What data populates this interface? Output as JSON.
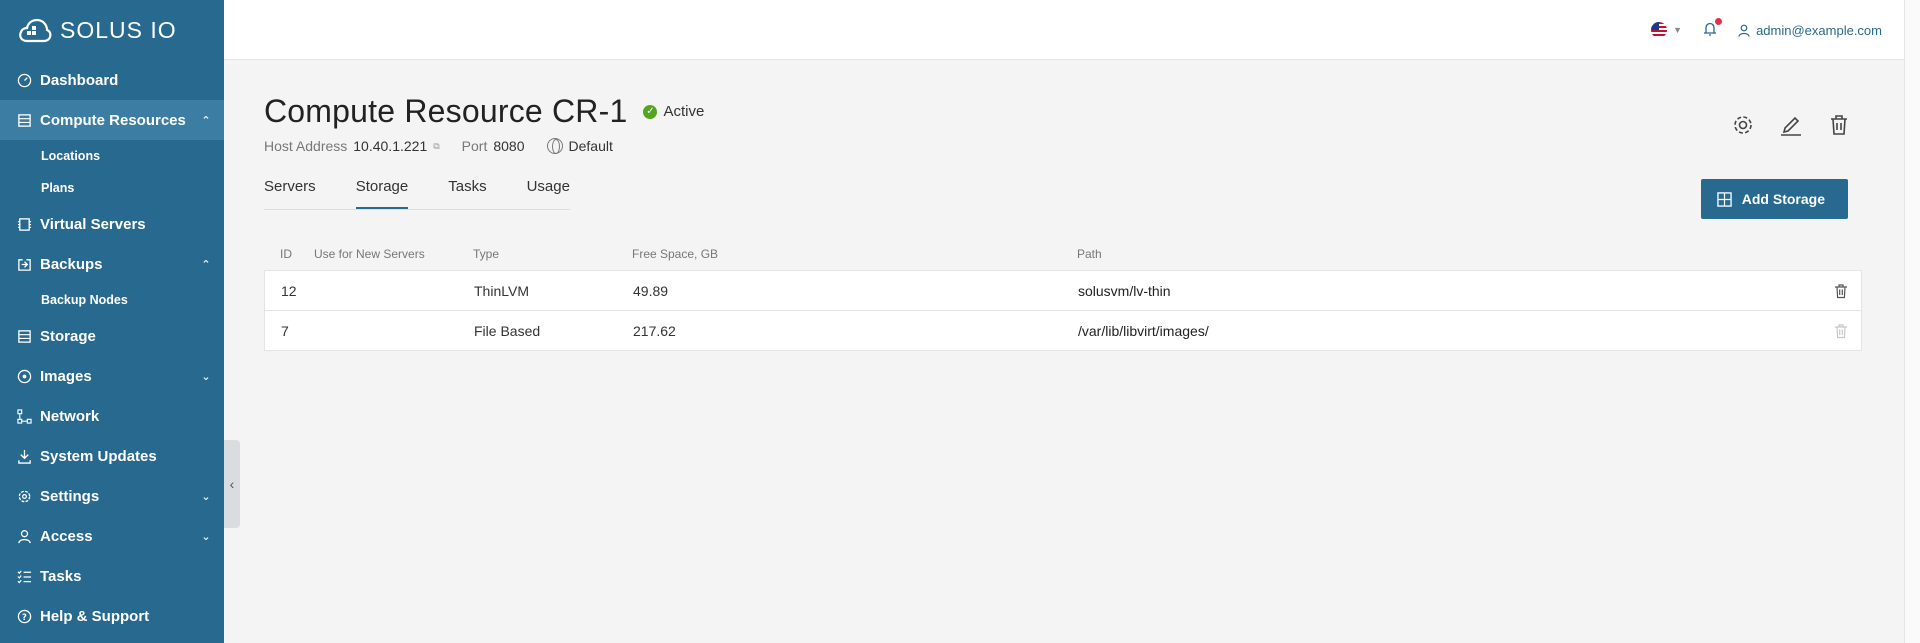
{
  "brand": {
    "name": "SOLUS IO"
  },
  "header": {
    "language_flag": "us-flag-icon",
    "user_email": "admin@example.com"
  },
  "sidebar": {
    "items": [
      {
        "label": "Dashboard",
        "icon": "dashboard-icon"
      },
      {
        "label": "Compute Resources",
        "icon": "compute-resources-icon",
        "expanded": true,
        "children": [
          {
            "label": "Locations"
          },
          {
            "label": "Plans"
          }
        ]
      },
      {
        "label": "Virtual Servers",
        "icon": "virtual-servers-icon"
      },
      {
        "label": "Backups",
        "icon": "backups-icon",
        "expanded": true,
        "children": [
          {
            "label": "Backup Nodes"
          }
        ]
      },
      {
        "label": "Storage",
        "icon": "storage-icon"
      },
      {
        "label": "Images",
        "icon": "images-icon",
        "expanded": false
      },
      {
        "label": "Network",
        "icon": "network-icon"
      },
      {
        "label": "System Updates",
        "icon": "system-updates-icon"
      },
      {
        "label": "Settings",
        "icon": "settings-icon",
        "expanded": false
      },
      {
        "label": "Access",
        "icon": "access-icon",
        "expanded": false
      },
      {
        "label": "Tasks",
        "icon": "tasks-icon"
      },
      {
        "label": "Help & Support",
        "icon": "help-icon"
      }
    ]
  },
  "page": {
    "title": "Compute Resource CR-1",
    "status": "Active",
    "host_label": "Host Address",
    "host_value": "10.40.1.221",
    "port_label": "Port",
    "port_value": "8080",
    "location": "Default",
    "tabs": [
      "Servers",
      "Storage",
      "Tasks",
      "Usage"
    ],
    "active_tab": "Storage",
    "add_button": "Add Storage"
  },
  "table": {
    "columns": [
      "ID",
      "Use for New Servers",
      "Type",
      "Free Space, GB",
      "Path"
    ],
    "rows": [
      {
        "id": "12",
        "use_for_new": false,
        "type": "ThinLVM",
        "free": "49.89",
        "path": "solusvm/lv-thin"
      },
      {
        "id": "7",
        "use_for_new": true,
        "type": "File Based",
        "free": "217.62",
        "path": "/var/lib/libvirt/images/"
      }
    ]
  },
  "colors": {
    "sidebar": "#28698f",
    "sidebar_active": "#3c7ea3",
    "primary": "#28698f",
    "toggle_on": "#2899d9",
    "status_ok": "#52a621"
  }
}
